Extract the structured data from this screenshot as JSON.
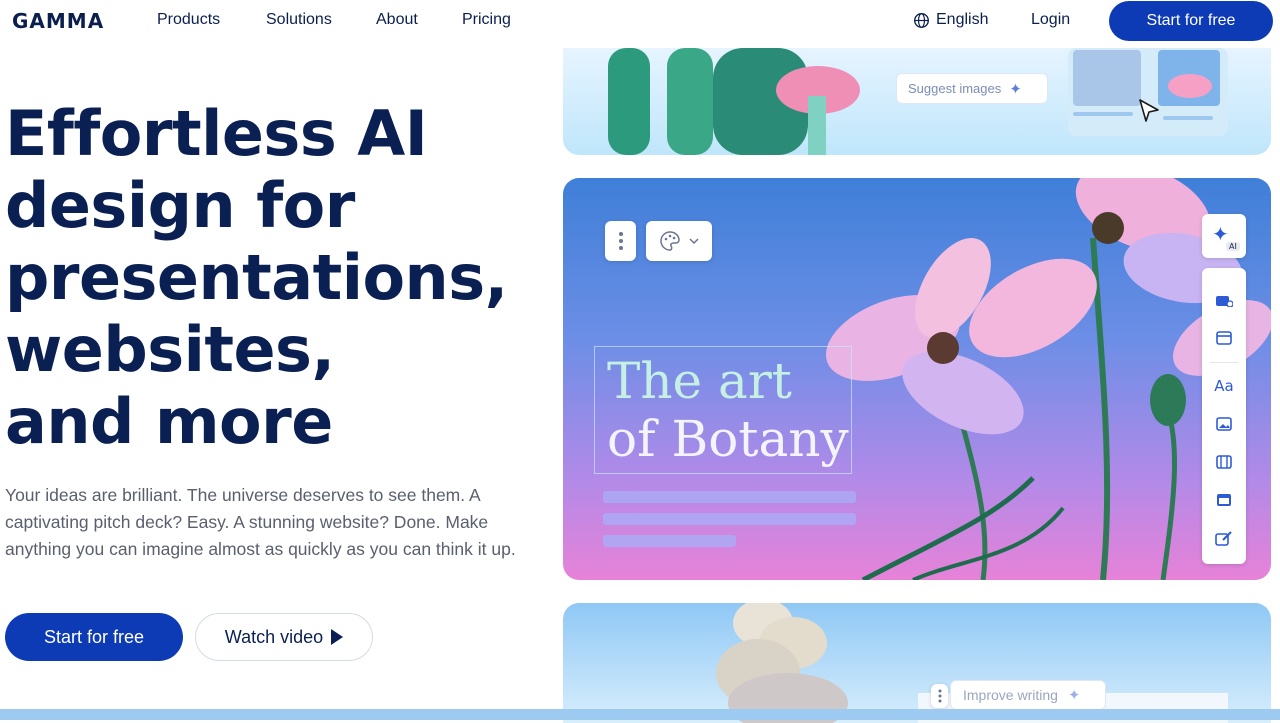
{
  "nav": {
    "logo": "GAMMA",
    "links": [
      "Products",
      "Solutions",
      "About",
      "Pricing"
    ],
    "language": "English",
    "login": "Login",
    "cta": "Start for free"
  },
  "hero": {
    "headline_lines": [
      "Effortless AI",
      "design for",
      "presentations,",
      "websites,",
      "and more"
    ],
    "subtitle": "Your ideas are brilliant. The universe deserves to see them. A captivating pitch deck? Easy. A stunning website? Done. Make anything you can imagine almost as quickly as you can think it up.",
    "primary_button": "Start for free",
    "secondary_button": "Watch video"
  },
  "preview": {
    "suggest_label": "Suggest images",
    "card_title_line1": "The art",
    "card_title_line2": "of Botany",
    "improve_label": "Improve writing",
    "ai_badge": "AI",
    "toolbar_icons": [
      "card-add-icon",
      "layout-icon",
      "text-icon",
      "image-icon",
      "video-icon",
      "embed-icon",
      "edit-icon"
    ]
  },
  "colors": {
    "brand": "#0c3bb5",
    "heading": "#0a1f52"
  }
}
